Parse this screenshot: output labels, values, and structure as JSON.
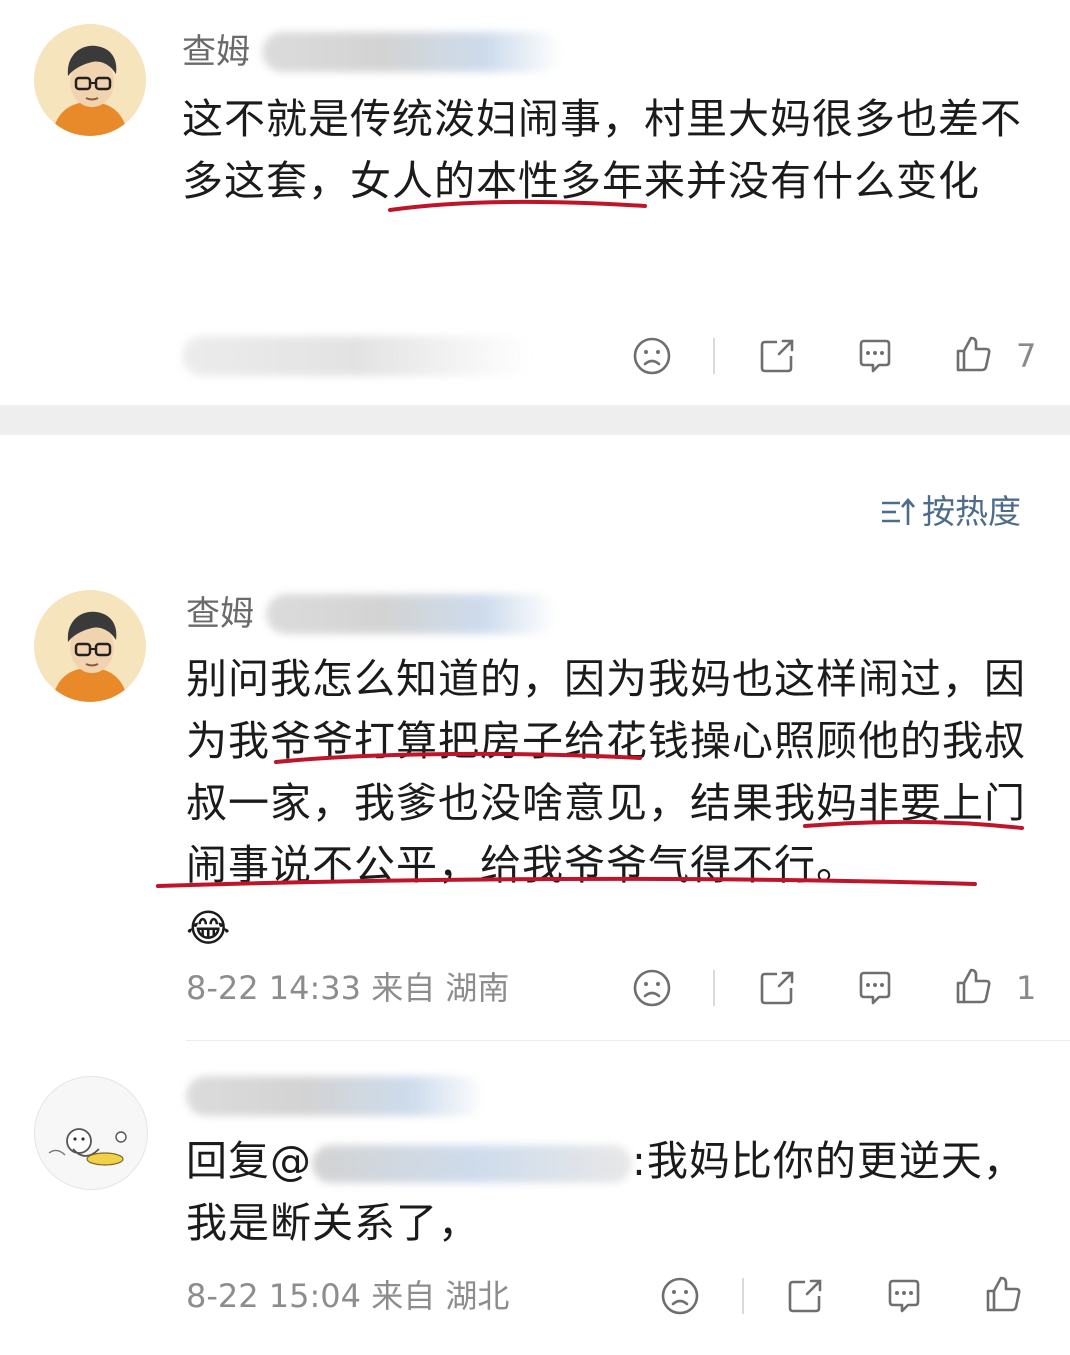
{
  "comments": [
    {
      "user_visible": "查姆",
      "text": "这不就是传统泼妇闹事，村里大妈很多也差不多这套，女人的本性多年来并没有什么变化",
      "meta": "",
      "like_count": "7"
    },
    {
      "user_visible": "查姆",
      "text": "别问我怎么知道的，因为我妈也这样闹过，因为我爷爷打算把房子给花钱操心照顾他的我叔叔一家，我爹也没啥意见，结果我妈非要上门闹事说不公平，给我爷爷气得不行。",
      "emoji": "😂",
      "meta": "8-22 14:33 来自 湖南",
      "like_count": "1"
    },
    {
      "reply_prefix": "回复@",
      "reply_suffix": ":我妈比你的更逆天，我是断关系了，",
      "meta": "8-22 15:04 来自 湖北",
      "like_count": ""
    }
  ],
  "sort": {
    "label": "按热度",
    "icon": "sort-icon"
  },
  "icons": [
    "dislike-icon",
    "share-icon",
    "comment-icon",
    "like-icon"
  ],
  "colors": {
    "underline": "#c0142a",
    "meta": "#8d8d8d",
    "sort": "#4d6b8a"
  }
}
